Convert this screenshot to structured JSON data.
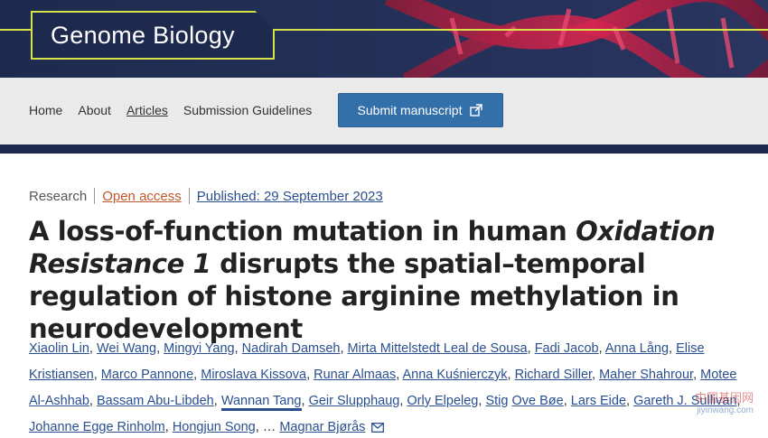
{
  "header": {
    "journal_name": "Genome Biology"
  },
  "nav": {
    "items": [
      {
        "label": "Home"
      },
      {
        "label": "About"
      },
      {
        "label": "Articles"
      },
      {
        "label": "Submission Guidelines"
      }
    ],
    "submit_label": "Submit manuscript"
  },
  "article": {
    "type": "Research",
    "access": "Open access",
    "published": "Published: 29 September 2023",
    "title_part1": "A loss-of-function mutation in human ",
    "title_italic": "Oxidation Resistance 1",
    "title_part2": " disrupts the spatial–temporal regulation of histone arginine methylation in neurodevelopment",
    "authors": [
      "Xiaolin Lin",
      "Wei Wang",
      "Mingyi Yang",
      "Nadirah Damseh",
      "Mirta Mittelstedt Leal de Sousa",
      "Fadi Jacob",
      "Anna Lång",
      "Elise Kristiansen",
      "Marco Pannone",
      "Miroslava Kissova",
      "Runar Almaas",
      "Anna Kuśnierczyk",
      "Richard Siller",
      "Maher Shahrour",
      "Motee Al-Ashhab",
      "Bassam Abu-Libdeh",
      "Wannan Tang",
      "Geir Slupphaug",
      "Orly Elpeleg",
      "Stig",
      "Ove Bøe",
      "Lars Eide",
      "Gareth J. Sullivan",
      "Johanne Egge Rinholm",
      "Hongjun Song"
    ],
    "ellipsis": "…",
    "last_author": "Magnar Bjørås"
  },
  "watermark": {
    "line1": "中国基因网",
    "line2": "jiyinwang.com"
  },
  "colors": {
    "banner": "#1e2a4d",
    "accent": "#d7e24a",
    "link": "#2a4f8f",
    "button": "#336fa8",
    "open_access": "#c0572a"
  }
}
